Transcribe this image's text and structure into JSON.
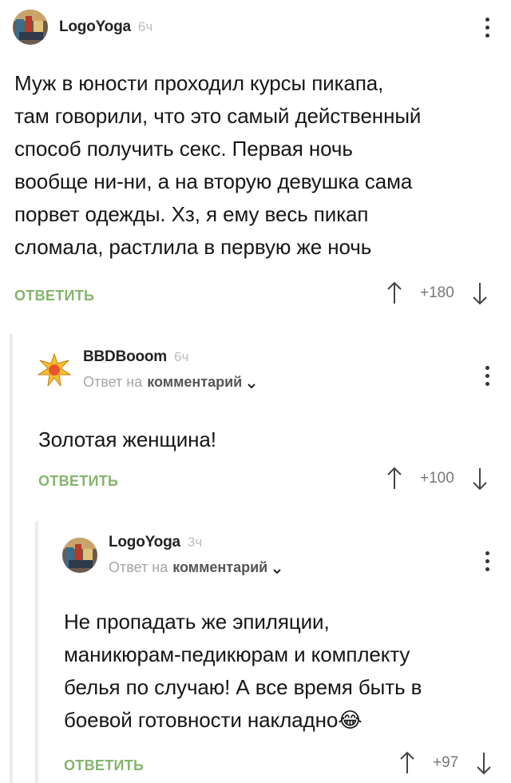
{
  "comments": [
    {
      "username": "LogoYoga",
      "time": "6ч",
      "avatar": "logoyoga-avatar",
      "text": [
        "Муж в юности проходил курсы пикапа,",
        "там говорили, что это самый действенный",
        "способ получить секс. Первая ночь",
        "вообще ни-ни, а на вторую девушка сама",
        "порвет одежды. Хз, я ему весь пикап",
        "сломала, растлила в первую же ночь"
      ],
      "reply_label": "ОТВЕТИТЬ",
      "score": "+180"
    },
    {
      "username": "BBDBooom",
      "time": "6ч",
      "avatar": "bbdbooom-avatar",
      "reply_to_prefix": "Ответ на",
      "reply_to_target": "комментарий",
      "text": [
        "Золотая женщина!"
      ],
      "reply_label": "ОТВЕТИТЬ",
      "score": "+100"
    },
    {
      "username": "LogoYoga",
      "time": "3ч",
      "avatar": "logoyoga-avatar",
      "reply_to_prefix": "Ответ на",
      "reply_to_target": "комментарий",
      "text": [
        "Не пропадать же эпиляции,",
        "маникюрам-педикюрам и комплекту",
        "белья по случаю! А все время быть в",
        "боевой готовности накладно😂"
      ],
      "reply_label": "ОТВЕТИТЬ",
      "score": "+97"
    }
  ],
  "icons": {
    "menu": "more-vertical-icon",
    "upvote": "arrow-up-icon",
    "downvote": "arrow-down-icon",
    "expand": "chevron-down-icon"
  },
  "colors": {
    "accent_green": "#84b56c",
    "thread_line": "#ececec",
    "muted_text": "#a6a6a6"
  }
}
